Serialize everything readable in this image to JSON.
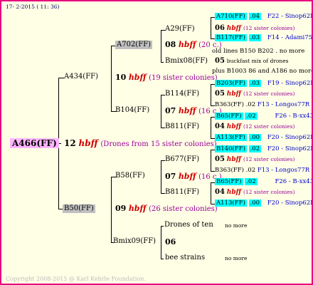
{
  "header": {
    "date": "17- 2-2015 ( 11: 36)"
  },
  "footer": {
    "copyright": "Copyright 2008-2015 @ Karl Kehrle Foundation."
  },
  "root": {
    "id": "A466(FF)",
    "gen_num": "12",
    "hbff": "hbff",
    "note": "(Drones from 15 sister colonies)"
  },
  "gen1": {
    "upper": {
      "id": "A434(FF)",
      "gen_num": "10",
      "hbff": "hbff",
      "note": "(19 sister colonies)"
    },
    "lower": {
      "id": "B50(FF)",
      "gen_num": "09",
      "hbff": "hbff",
      "note": "(26 sister colonies)"
    }
  },
  "gen2": {
    "a702": {
      "id": "A702(FF)",
      "gen_num": "08",
      "hbff": "hbff",
      "note": "(20 c.)"
    },
    "b104": {
      "id": "B104(FF)",
      "gen_num": "07",
      "hbff": "hbff",
      "note": "(16 c.)"
    },
    "b58": {
      "id": "B58(FF)",
      "gen_num": "07",
      "hbff": "hbff",
      "note": "(16 c.)"
    },
    "bmix09": {
      "id": "Bmix09(FF)",
      "gen_num": "06"
    }
  },
  "gen3": {
    "a29": {
      "id": "A29(FF)",
      "gen_num": "06",
      "hbff": "hbff",
      "note": "(12 sister colonies)"
    },
    "bmix08": {
      "id": "Bmix08(FF)",
      "gen_num": "05",
      "note": "buckfast mix of drones"
    },
    "b114": {
      "id": "B114(FF)",
      "gen_num": "05",
      "hbff": "hbff",
      "note": "(12 sister colonies)"
    },
    "b811a": {
      "id": "B811(FF)",
      "gen_num": "04",
      "hbff": "hbff",
      "note": "(12 sister colonies)"
    },
    "b677": {
      "id": "B677(FF)",
      "gen_num": "05",
      "hbff": "hbff",
      "note": "(12 sister colonies)"
    },
    "b811b": {
      "id": "B811(FF)",
      "gen_num": "04",
      "hbff": "hbff",
      "note": "(12 sister colonies)"
    },
    "drones_ten": {
      "id": "Drones of ten",
      "note": "no more"
    },
    "bee_strains": {
      "id": "bee strains",
      "note": "no more"
    }
  },
  "gen4": [
    {
      "id": "A710(FF)",
      "num": ".04",
      "source": "F22 - Sinop62R"
    },
    {
      "id": "B117(FF)",
      "num": ".03",
      "source": "F14 - Adami75R"
    },
    {
      "id": "",
      "num": "",
      "source": "old lines B150 B202 . no more"
    },
    {
      "id": "",
      "num": "",
      "source": "plus B1003 86 and A186 no more"
    },
    {
      "id": "B203(FF)",
      "num": ".03",
      "source": "F19 - Sinop62R"
    },
    {
      "id": "B363(FF)",
      "num": ".02",
      "source": "F13 - Longos77R"
    },
    {
      "id": "B65(FF)",
      "num": ".02",
      "source": "F26 - B-xx43"
    },
    {
      "id": "A113(FF)",
      "num": ".00",
      "source": "F20 - Sinop62R"
    },
    {
      "id": "B140(FF)",
      "num": ".02",
      "source": "F20 - Sinop62R"
    },
    {
      "id": "B363(FF)",
      "num": ".02",
      "source": "F13 - Longos77R"
    },
    {
      "id": "B65(FF)",
      "num": ".02",
      "source": "F26 - B-xx43"
    },
    {
      "id": "A113(FF)",
      "num": ".00",
      "source": "F20 - Sinop62R"
    }
  ]
}
